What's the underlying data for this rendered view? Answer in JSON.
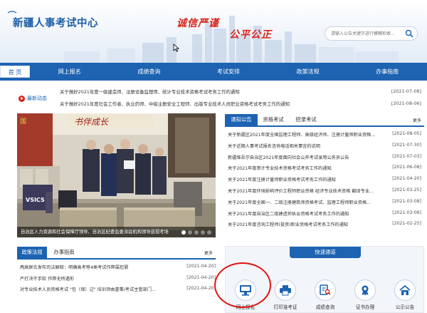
{
  "header": {
    "site_title": "新疆人事考试中心",
    "slogan_left": "诚信严谨",
    "slogan_right": "公平公正",
    "search_placeholder": "请输入公告关键字进行模糊检索..."
  },
  "nav": {
    "items": [
      {
        "label": "首 页",
        "active": true
      },
      {
        "label": "网上报名"
      },
      {
        "label": "成绩查询"
      },
      {
        "label": "考试安排"
      },
      {
        "label": "政策法规"
      },
      {
        "label": "办事指南"
      }
    ]
  },
  "latest": {
    "label": "最新动态",
    "items": [
      {
        "title": "关于做好2021年度一级建造师、注册设备监理师、统计专业技术资格考试考务工作的通知",
        "date": "[2021-07-08]"
      },
      {
        "title": "关于做好2021年度社会工作者、执业药师、中级注册安全工程师、出版专业技术人员职业资格考试考务工作的通知",
        "date": "[2021-08-06]"
      }
    ]
  },
  "photo": {
    "caption": "自治区人力资源和社会保障厅领导、自治区纪委监委派驻机构领导巡视考场"
  },
  "notice": {
    "tabs": [
      "通知公告",
      "资格考试",
      "招录考试"
    ],
    "more": "更多",
    "items": [
      {
        "title": "关于新疆区2021年度全国监理工程师、高级经济师、注册计量师职业资格...",
        "date": "[2021-08-05]"
      },
      {
        "title": "关于近期人事考试报名咨询电话相关事宜的说明",
        "date": "[2021-07-30]"
      },
      {
        "title": "新疆维吾尔自治区2021年度面向社会公开考试录用公务员公告",
        "date": "[2021-07-03]"
      },
      {
        "title": "关于2021年度审计专业技术资格考试考务工作的通知",
        "date": "[2021-06-08]"
      },
      {
        "title": "关于2021年度注册计量师职业资格考试考务工作的通知",
        "date": "[2021-04-20]"
      },
      {
        "title": "关于2021年度环境影响评价工程师职业资格 经济专业技术资格 翻译专业...",
        "date": "[2021-03-25]"
      },
      {
        "title": "关于2021年度全国一、二级注册建筑师资格考试、监理工程师职业资格...",
        "date": "[2021-03-08]"
      },
      {
        "title": "关于2021年度自治区二级建造师执业资格考试考务工作的通知",
        "date": "[2021-03-08]"
      },
      {
        "title": "关于2021年度咨询工程师(投资)职业资格考试考务工作的通知",
        "date": "[2021-02-25]"
      }
    ]
  },
  "policy": {
    "tabs": [
      "政策法规",
      "办事指南"
    ],
    "more": "更多",
    "items": [
      {
        "title": "两高联合发布司法解释：明确高考等4类考试作弊属犯罪",
        "date": "[2021-04-20]"
      },
      {
        "title": "严打决不手软 作弊无所遁形",
        "date": "[2021-04-20]"
      },
      {
        "title": "对专业技术人员资格考试 \"包（保）过\" 培训须由重事/考试主管部门...",
        "date": "[2021-04-20]"
      }
    ]
  },
  "quick": {
    "title": "快速通道",
    "items": [
      {
        "label": "网上报名",
        "icon": "computer-icon"
      },
      {
        "label": "打印准考证",
        "icon": "printer-icon"
      },
      {
        "label": "成绩查询",
        "icon": "document-search-icon"
      },
      {
        "label": "证书办理",
        "icon": "certificate-icon"
      },
      {
        "label": "公示公告",
        "icon": "home-notice-icon"
      }
    ]
  },
  "colors": {
    "primary": "#1d63b2",
    "slogan": "#d8231a",
    "highlight": "#e01410"
  }
}
